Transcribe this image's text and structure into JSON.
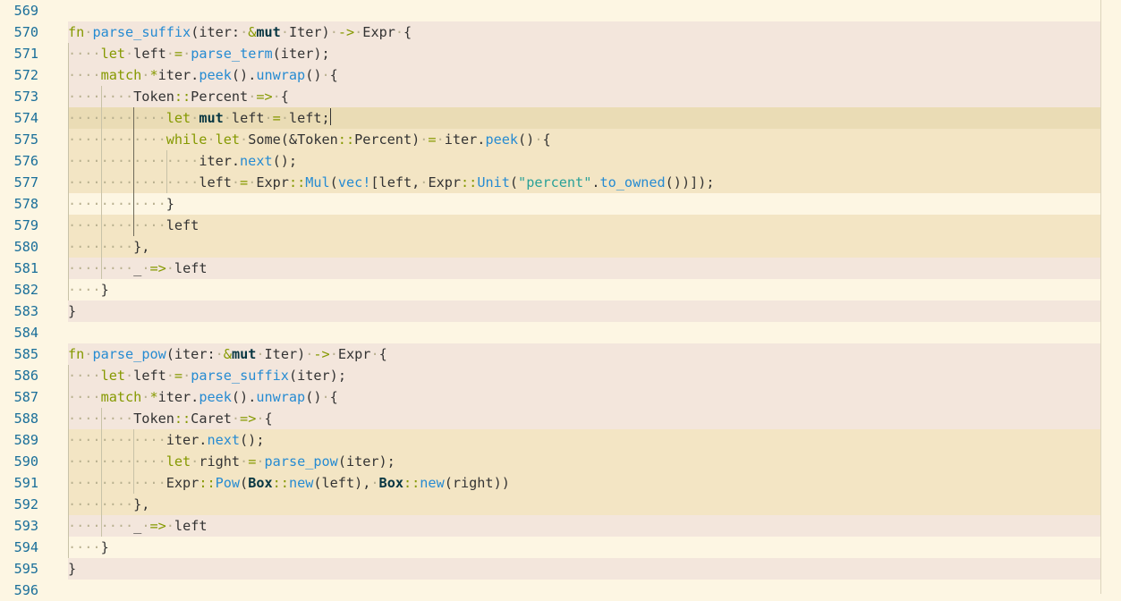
{
  "editor": {
    "language": "rust",
    "colors": {
      "background": "#fdf6e3",
      "line_number": "#1a6f9a",
      "keyword": "#859900",
      "function": "#268bd2",
      "string": "#2aa198",
      "highlight_pink": "#f3e6dc",
      "highlight_yellow": "#f3e5c4",
      "current_line": "#eadcb5"
    },
    "cursor_line": 574,
    "lines": [
      {
        "n": "569",
        "hl": "none",
        "tokens": []
      },
      {
        "n": "570",
        "hl": "pink",
        "tokens": [
          [
            "kw",
            "fn"
          ],
          [
            "ws",
            "·"
          ],
          [
            "fn",
            "parse_suffix"
          ],
          [
            "t",
            "(iter:"
          ],
          [
            "ws",
            "·"
          ],
          [
            "op",
            "&"
          ],
          [
            "bold",
            "mut"
          ],
          [
            "ws",
            "·"
          ],
          [
            "t",
            "Iter)"
          ],
          [
            "ws",
            "·"
          ],
          [
            "op",
            "->"
          ],
          [
            "ws",
            "·"
          ],
          [
            "t",
            "Expr"
          ],
          [
            "ws",
            "·"
          ],
          [
            "t",
            "{"
          ]
        ]
      },
      {
        "n": "571",
        "hl": "pink",
        "tokens": [
          [
            "ws",
            "····"
          ],
          [
            "kw",
            "let"
          ],
          [
            "ws",
            "·"
          ],
          [
            "t",
            "left"
          ],
          [
            "ws",
            "·"
          ],
          [
            "op",
            "="
          ],
          [
            "ws",
            "·"
          ],
          [
            "fn",
            "parse_term"
          ],
          [
            "t",
            "(iter);"
          ]
        ]
      },
      {
        "n": "572",
        "hl": "pink",
        "tokens": [
          [
            "ws",
            "····"
          ],
          [
            "kw",
            "match"
          ],
          [
            "ws",
            "·"
          ],
          [
            "op",
            "*"
          ],
          [
            "t",
            "iter."
          ],
          [
            "fn",
            "peek"
          ],
          [
            "t",
            "()."
          ],
          [
            "fn",
            "unwrap"
          ],
          [
            "t",
            "()"
          ],
          [
            "ws",
            "·"
          ],
          [
            "t",
            "{"
          ]
        ]
      },
      {
        "n": "573",
        "hl": "pink",
        "tokens": [
          [
            "ws",
            "········"
          ],
          [
            "t",
            "Token"
          ],
          [
            "op",
            "::"
          ],
          [
            "t",
            "Percent"
          ],
          [
            "ws",
            "·"
          ],
          [
            "op",
            "=>"
          ],
          [
            "ws",
            "·"
          ],
          [
            "t",
            "{"
          ]
        ]
      },
      {
        "n": "574",
        "hl": "current",
        "tokens": [
          [
            "ws",
            "············"
          ],
          [
            "kw",
            "let"
          ],
          [
            "ws",
            "·"
          ],
          [
            "bold",
            "mut"
          ],
          [
            "ws",
            "·"
          ],
          [
            "t",
            "left"
          ],
          [
            "ws",
            "·"
          ],
          [
            "op",
            "="
          ],
          [
            "ws",
            "·"
          ],
          [
            "t",
            "left;"
          ],
          [
            "caret",
            ""
          ]
        ]
      },
      {
        "n": "575",
        "hl": "yellow",
        "tokens": [
          [
            "ws",
            "············"
          ],
          [
            "kw",
            "while"
          ],
          [
            "ws",
            "·"
          ],
          [
            "kw",
            "let"
          ],
          [
            "ws",
            "·"
          ],
          [
            "t",
            "Some(&Token"
          ],
          [
            "op",
            "::"
          ],
          [
            "t",
            "Percent)"
          ],
          [
            "ws",
            "·"
          ],
          [
            "op",
            "="
          ],
          [
            "ws",
            "·"
          ],
          [
            "t",
            "iter."
          ],
          [
            "fn",
            "peek"
          ],
          [
            "t",
            "()"
          ],
          [
            "ws",
            "·"
          ],
          [
            "t",
            "{"
          ]
        ]
      },
      {
        "n": "576",
        "hl": "yellow",
        "tokens": [
          [
            "ws",
            "················"
          ],
          [
            "t",
            "iter."
          ],
          [
            "fn",
            "next"
          ],
          [
            "t",
            "();"
          ]
        ]
      },
      {
        "n": "577",
        "hl": "yellow",
        "tokens": [
          [
            "ws",
            "················"
          ],
          [
            "t",
            "left"
          ],
          [
            "ws",
            "·"
          ],
          [
            "op",
            "="
          ],
          [
            "ws",
            "·"
          ],
          [
            "t",
            "Expr"
          ],
          [
            "op",
            "::"
          ],
          [
            "fn",
            "Mul"
          ],
          [
            "t",
            "("
          ],
          [
            "fn",
            "vec!"
          ],
          [
            "t",
            "[left,"
          ],
          [
            "ws",
            "·"
          ],
          [
            "t",
            "Expr"
          ],
          [
            "op",
            "::"
          ],
          [
            "fn",
            "Unit"
          ],
          [
            "t",
            "("
          ],
          [
            "str",
            "\"percent\""
          ],
          [
            "t",
            "."
          ],
          [
            "fn",
            "to_owned"
          ],
          [
            "t",
            "())]);"
          ]
        ]
      },
      {
        "n": "578",
        "hl": "none",
        "tokens": [
          [
            "ws",
            "············"
          ],
          [
            "t",
            "}"
          ]
        ]
      },
      {
        "n": "579",
        "hl": "yellow",
        "tokens": [
          [
            "ws",
            "············"
          ],
          [
            "t",
            "left"
          ]
        ]
      },
      {
        "n": "580",
        "hl": "yellow",
        "tokens": [
          [
            "ws",
            "········"
          ],
          [
            "t",
            "},"
          ]
        ]
      },
      {
        "n": "581",
        "hl": "pink",
        "tokens": [
          [
            "ws",
            "········"
          ],
          [
            "t",
            "_"
          ],
          [
            "ws",
            "·"
          ],
          [
            "op",
            "=>"
          ],
          [
            "ws",
            "·"
          ],
          [
            "t",
            "left"
          ]
        ]
      },
      {
        "n": "582",
        "hl": "none",
        "tokens": [
          [
            "ws",
            "····"
          ],
          [
            "t",
            "}"
          ]
        ]
      },
      {
        "n": "583",
        "hl": "pink",
        "tokens": [
          [
            "t",
            "}"
          ]
        ]
      },
      {
        "n": "584",
        "hl": "none",
        "tokens": []
      },
      {
        "n": "585",
        "hl": "pink",
        "tokens": [
          [
            "kw",
            "fn"
          ],
          [
            "ws",
            "·"
          ],
          [
            "fn",
            "parse_pow"
          ],
          [
            "t",
            "(iter:"
          ],
          [
            "ws",
            "·"
          ],
          [
            "op",
            "&"
          ],
          [
            "bold",
            "mut"
          ],
          [
            "ws",
            "·"
          ],
          [
            "t",
            "Iter)"
          ],
          [
            "ws",
            "·"
          ],
          [
            "op",
            "->"
          ],
          [
            "ws",
            "·"
          ],
          [
            "t",
            "Expr"
          ],
          [
            "ws",
            "·"
          ],
          [
            "t",
            "{"
          ]
        ]
      },
      {
        "n": "586",
        "hl": "pink",
        "tokens": [
          [
            "ws",
            "····"
          ],
          [
            "kw",
            "let"
          ],
          [
            "ws",
            "·"
          ],
          [
            "t",
            "left"
          ],
          [
            "ws",
            "·"
          ],
          [
            "op",
            "="
          ],
          [
            "ws",
            "·"
          ],
          [
            "fn",
            "parse_suffix"
          ],
          [
            "t",
            "(iter);"
          ]
        ]
      },
      {
        "n": "587",
        "hl": "pink",
        "tokens": [
          [
            "ws",
            "····"
          ],
          [
            "kw",
            "match"
          ],
          [
            "ws",
            "·"
          ],
          [
            "op",
            "*"
          ],
          [
            "t",
            "iter."
          ],
          [
            "fn",
            "peek"
          ],
          [
            "t",
            "()."
          ],
          [
            "fn",
            "unwrap"
          ],
          [
            "t",
            "()"
          ],
          [
            "ws",
            "·"
          ],
          [
            "t",
            "{"
          ]
        ]
      },
      {
        "n": "588",
        "hl": "pink",
        "tokens": [
          [
            "ws",
            "········"
          ],
          [
            "t",
            "Token"
          ],
          [
            "op",
            "::"
          ],
          [
            "t",
            "Caret"
          ],
          [
            "ws",
            "·"
          ],
          [
            "op",
            "=>"
          ],
          [
            "ws",
            "·"
          ],
          [
            "t",
            "{"
          ]
        ]
      },
      {
        "n": "589",
        "hl": "yellow",
        "tokens": [
          [
            "ws",
            "············"
          ],
          [
            "t",
            "iter."
          ],
          [
            "fn",
            "next"
          ],
          [
            "t",
            "();"
          ]
        ]
      },
      {
        "n": "590",
        "hl": "yellow",
        "tokens": [
          [
            "ws",
            "············"
          ],
          [
            "kw",
            "let"
          ],
          [
            "ws",
            "·"
          ],
          [
            "t",
            "right"
          ],
          [
            "ws",
            "·"
          ],
          [
            "op",
            "="
          ],
          [
            "ws",
            "·"
          ],
          [
            "fn",
            "parse_pow"
          ],
          [
            "t",
            "(iter);"
          ]
        ]
      },
      {
        "n": "591",
        "hl": "yellow",
        "tokens": [
          [
            "ws",
            "············"
          ],
          [
            "t",
            "Expr"
          ],
          [
            "op",
            "::"
          ],
          [
            "fn",
            "Pow"
          ],
          [
            "t",
            "("
          ],
          [
            "bold",
            "Box"
          ],
          [
            "op",
            "::"
          ],
          [
            "fn",
            "new"
          ],
          [
            "t",
            "(left),"
          ],
          [
            "ws",
            "·"
          ],
          [
            "bold",
            "Box"
          ],
          [
            "op",
            "::"
          ],
          [
            "fn",
            "new"
          ],
          [
            "t",
            "(right))"
          ]
        ]
      },
      {
        "n": "592",
        "hl": "yellow",
        "tokens": [
          [
            "ws",
            "········"
          ],
          [
            "t",
            "},"
          ]
        ]
      },
      {
        "n": "593",
        "hl": "pink",
        "tokens": [
          [
            "ws",
            "········"
          ],
          [
            "t",
            "_"
          ],
          [
            "ws",
            "·"
          ],
          [
            "op",
            "=>"
          ],
          [
            "ws",
            "·"
          ],
          [
            "t",
            "left"
          ]
        ]
      },
      {
        "n": "594",
        "hl": "none",
        "tokens": [
          [
            "ws",
            "····"
          ],
          [
            "t",
            "}"
          ]
        ]
      },
      {
        "n": "595",
        "hl": "pink",
        "tokens": [
          [
            "t",
            "}"
          ]
        ]
      },
      {
        "n": "596",
        "hl": "none",
        "tokens": []
      }
    ]
  }
}
